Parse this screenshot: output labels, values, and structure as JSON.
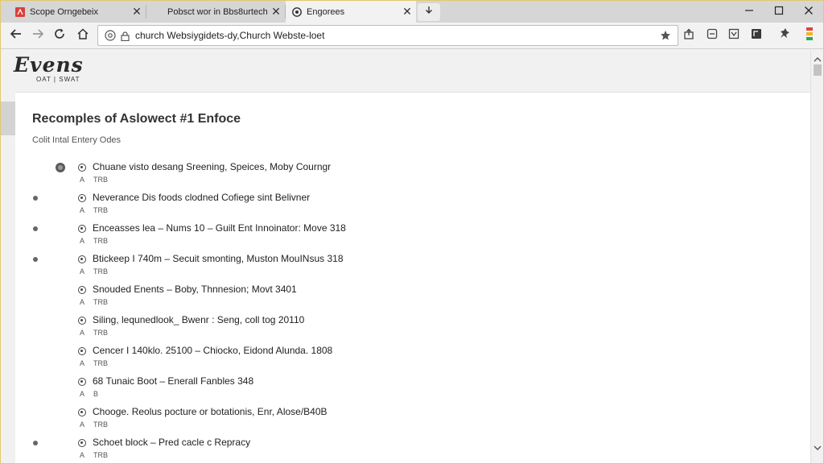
{
  "browser": {
    "tabs": [
      {
        "title": "Scope Orngebeix",
        "favicon": "pdf-icon",
        "favicon_color": "#d9403a",
        "close": "✕"
      },
      {
        "title": "Pobsct wor in Bbs8urtech",
        "close": "✕"
      },
      {
        "title": "Engorees",
        "favicon": "chrome-page-icon",
        "close": "✕"
      }
    ],
    "newtab_icon": "download-arrow-icon",
    "address": {
      "url": "church Websiygidets-dy,Church Webste-loet"
    }
  },
  "site": {
    "logo_main": "Evens",
    "logo_sub": "OAT | SWAT"
  },
  "main": {
    "title": "Recomples of Aslowect #1 Enfoce",
    "subtitle": "Colit Intal Entery Odes",
    "items": [
      {
        "label": "Chuane visto desang Sreening, Speices, Moby Courngr",
        "meta_icon": "A",
        "meta": "TRB"
      },
      {
        "label": "Neverance Dis foods clodned Cofiege sint Belivner",
        "meta_icon": "A",
        "meta": "TRB"
      },
      {
        "label": "Enceasses lea – Nums 10 – Guilt Ent Innoinator: Move 318",
        "meta_icon": "A",
        "meta": "TRB"
      },
      {
        "label": "Btickeep I 740m – Secuit smonting, Muston MouINsus 318",
        "meta_icon": "A",
        "meta": "TRB"
      },
      {
        "label": "Snouded Enents – Boby, Thnnesion; Movt 3401",
        "meta_icon": "A",
        "meta": "TRB"
      },
      {
        "label": "Siling, lequnedlook_ Bwenr : Seng, coll tog 20110",
        "meta_icon": "A",
        "meta": "TRB"
      },
      {
        "label": "Cencer I 140klo. 25100 – Chiocko, Eidond Alunda. 1808",
        "meta_icon": "A",
        "meta": "TRB"
      },
      {
        "label": "68 Tunaic Boot – Enerall Fanbles 348",
        "meta_icon": "A",
        "meta": "B"
      },
      {
        "label": "Chooge. Reolus pocture or botationis, Enr, Alose/B40B",
        "meta_icon": "A",
        "meta": "TRB"
      },
      {
        "label": "Schoet block – Pred cacle c Repracy",
        "meta_icon": "A",
        "meta": "TRB"
      }
    ]
  },
  "colors": {
    "window_border": "#e2c96a",
    "tab_strip": "#d6d6d6",
    "page_bg": "#f1f1f1",
    "content_bg": "#ffffff",
    "text": "#222222"
  }
}
